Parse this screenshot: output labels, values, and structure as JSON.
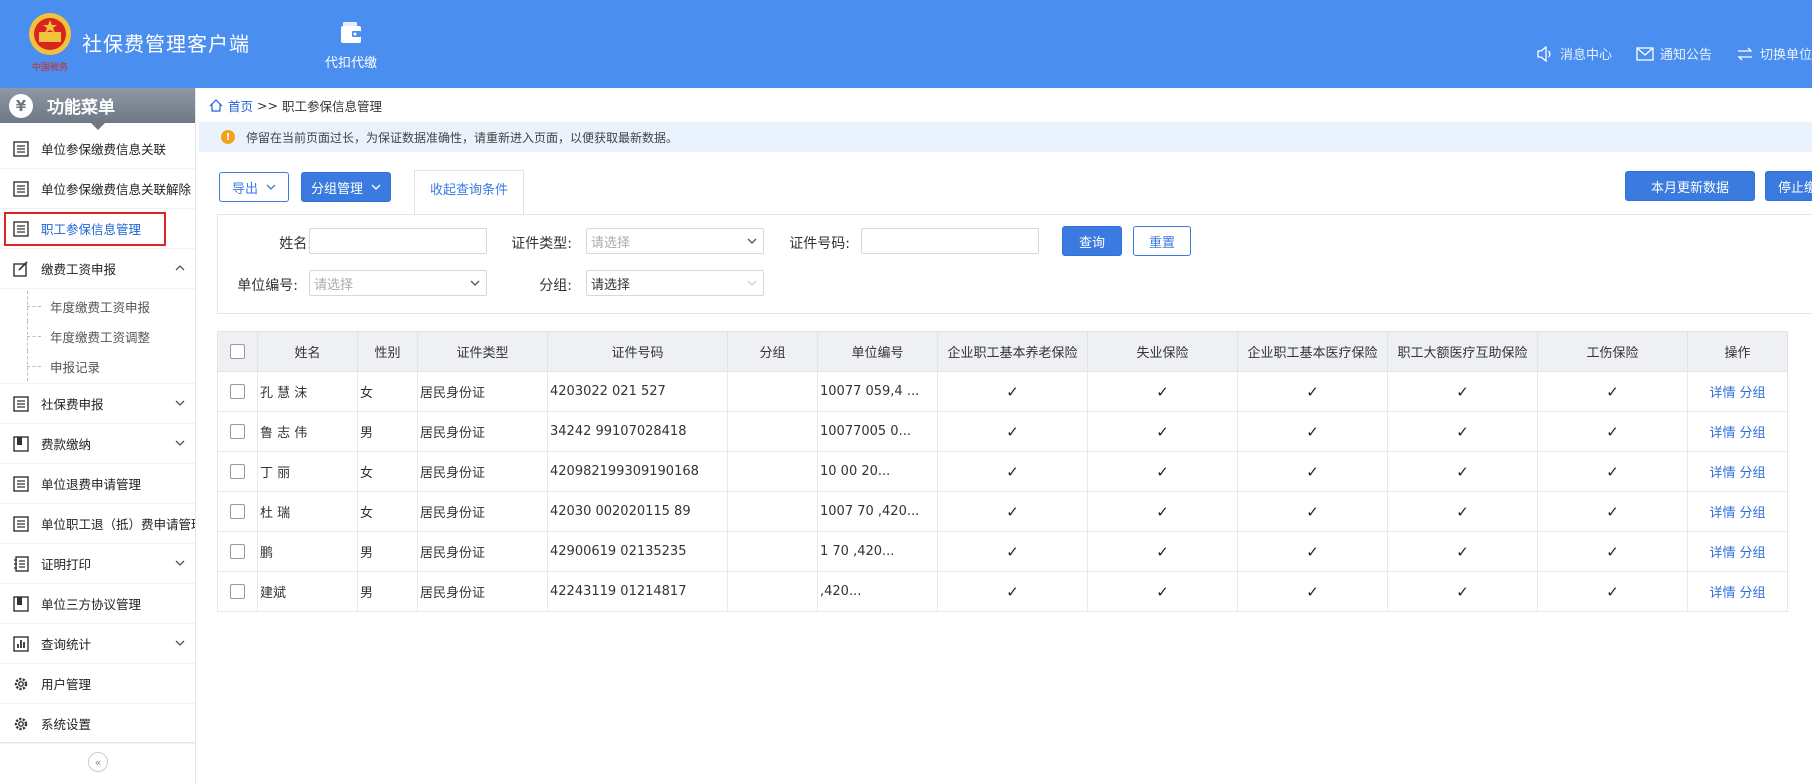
{
  "header": {
    "title": "社保费管理客户端",
    "logo_icon": "national-emblem-icon",
    "nav": [
      {
        "label": "代扣代缴",
        "icon": "wallet-icon"
      }
    ],
    "right": [
      {
        "label": "消息中心",
        "icon": "speaker-icon"
      },
      {
        "label": "通知公告",
        "icon": "mail-icon"
      },
      {
        "label": "切换单位",
        "icon": "swap-icon"
      }
    ],
    "colors": {
      "bg": "#4a8ef0"
    }
  },
  "sidebar": {
    "title": "功能菜单",
    "title_icon": "yen-icon",
    "items": [
      {
        "label": "单位参保缴费信息关联",
        "icon": "list-icon"
      },
      {
        "label": "单位参保缴费信息关联解除",
        "icon": "list-icon"
      },
      {
        "label": "职工参保信息管理",
        "icon": "list-icon",
        "active": true
      },
      {
        "label": "缴费工资申报",
        "icon": "edit-icon",
        "expanded": true,
        "children": [
          "年度缴费工资申报",
          "年度缴费工资调整",
          "申报记录"
        ]
      },
      {
        "label": "社保费申报",
        "icon": "list-icon"
      },
      {
        "label": "费款缴纳",
        "icon": "book-icon"
      },
      {
        "label": "单位退费申请管理",
        "icon": "list-icon"
      },
      {
        "label": "单位职工退（抵）费申请管理",
        "icon": "list-icon"
      },
      {
        "label": "证明打印",
        "icon": "print-list-icon"
      },
      {
        "label": "单位三方协议管理",
        "icon": "book-icon"
      },
      {
        "label": "查询统计",
        "icon": "bar-chart-icon"
      },
      {
        "label": "用户管理",
        "icon": "gear-icon"
      },
      {
        "label": "系统设置",
        "icon": "gear-icon"
      }
    ],
    "collapse_label": "«"
  },
  "breadcrumb": {
    "home": "首页",
    "sep": ">>",
    "current": "职工参保信息管理"
  },
  "notice": {
    "icon_text": "!",
    "text": "停留在当前页面过长，为保证数据准确性，请重新进入页面，以便获取最新数据。"
  },
  "toolbar": {
    "export_label": "导出",
    "group_label": "分组管理",
    "collapse_tab": "收起查询条件",
    "update_label": "本月更新数据",
    "stop_label": "停止缴"
  },
  "filter": {
    "name_label": "姓名:",
    "id_type_label": "证件类型:",
    "id_type_placeholder": "请选择",
    "id_no_label": "证件号码:",
    "unit_label": "单位编号:",
    "unit_placeholder": "请选择",
    "group_label": "分组:",
    "group_value": "请选择",
    "search_label": "查询",
    "reset_label": "重置"
  },
  "table": {
    "headers": [
      "姓名",
      "性别",
      "证件类型",
      "证件号码",
      "分组",
      "单位编号",
      "企业职工基本养老保险",
      "失业保险",
      "企业职工基本医疗保险",
      "职工大额医疗互助保险",
      "工伤保险",
      "操作"
    ],
    "check_mark": "✓",
    "ops": [
      "详情",
      "分组"
    ],
    "rows": [
      {
        "name": "孔 慧 沫",
        "gender": "女",
        "id_type": "居民身份证",
        "id_no": "4203022    021  527",
        "group": "",
        "unit": "10077 059,4 ..."
      },
      {
        "name": "鲁 志 伟",
        "gender": "男",
        "id_type": "居民身份证",
        "id_no": "34242   99107028418",
        "group": "",
        "unit": "10077005    0..."
      },
      {
        "name": "丁  丽",
        "gender": "女",
        "id_type": "居民身份证",
        "id_no": "420982199309190168",
        "group": "",
        "unit": "10    00     20..."
      },
      {
        "name": "杜  瑞",
        "gender": "女",
        "id_type": "居民身份证",
        "id_no": "42030   002020115 89",
        "group": "",
        "unit": "1007 70   ,420..."
      },
      {
        "name": "  鹏",
        "gender": "男",
        "id_type": "居民身份证",
        "id_no": "42900619   02135235",
        "group": "",
        "unit": "1  70    ,420..."
      },
      {
        "name": "  建斌",
        "gender": "男",
        "id_type": "居民身份证",
        "id_no": "42243119  01214817",
        "group": "",
        "unit": "        ,420..."
      }
    ]
  }
}
